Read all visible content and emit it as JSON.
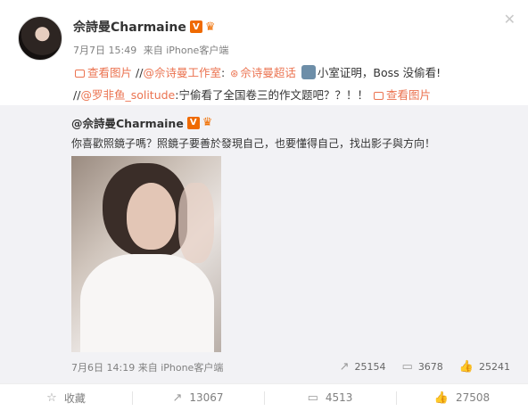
{
  "post": {
    "author": "佘詩曼Charmaine",
    "verified_icon": "V",
    "date": "7月7日 15:49",
    "source": "来自 iPhone客户端",
    "text_parts": {
      "view_image_1": "查看图片",
      "sep_1": " //",
      "mention_studio": "@佘诗曼工作室",
      "colon_1": ":",
      "supertopic": "佘诗曼超话",
      "text_1": "小室证明，Boss 没偷看!",
      "sep_2": "//",
      "mention_user": "@罗非鱼_solitude",
      "text_2": ":宁偷看了全国卷三的作文题吧？？！！",
      "view_image_2": "查看图片"
    }
  },
  "repost": {
    "author": "@佘詩曼Charmaine",
    "verified_icon": "V",
    "text": "你喜歡照鏡子嗎？照鏡子要善於發現自己，也要懂得自己，找出影子與方向！",
    "date": "7月6日 14:19",
    "source": "来自 iPhone客户端",
    "reposts": "25154",
    "comments": "3678",
    "likes": "25241"
  },
  "bottom": {
    "favorite": "收藏",
    "repost": "13067",
    "comment": "4513",
    "like": "27508"
  },
  "colors": {
    "link": "#eb7350",
    "repost_bg": "#f2f2f5",
    "verified": "#ef6a00"
  }
}
